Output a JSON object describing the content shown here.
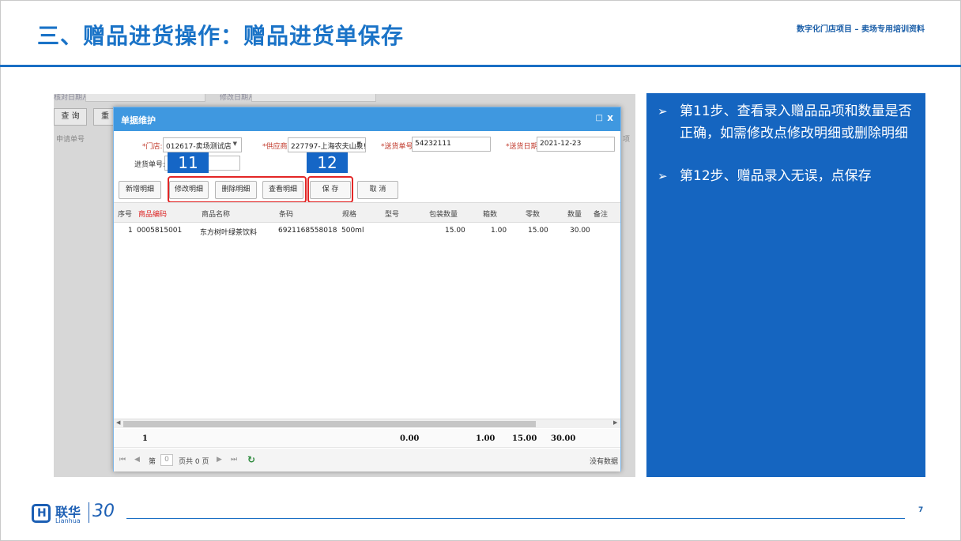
{
  "slide": {
    "title": "三、赠品进货操作：赠品进货单保存",
    "subtitle": "数字化门店项目 – 卖场专用培训资料",
    "page_number": "7"
  },
  "background_app": {
    "label_a": "核对日期从:",
    "label_b": "修改日期从:",
    "query_button": "查 询",
    "reset_button": "重",
    "column_apply_no": "申请单号",
    "column_right": "项"
  },
  "dialog": {
    "title": "单据维护",
    "max_icon": "□",
    "close_icon": "x",
    "fields": {
      "store_label": "*门店:",
      "store_value": "012617-卖场测试店",
      "supplier_label": "*供应商:",
      "supplier_value": "227797-上海农夫山泉!",
      "delivery_no_label": "*送货单号:",
      "delivery_no_value": "54232111",
      "delivery_date_label": "*送货日期:",
      "delivery_date_value": "2021-12-23",
      "purchase_no_label": "进货单号:",
      "purchase_no_value": ""
    },
    "buttons": {
      "add_detail": "新增明细",
      "edit_detail": "修改明细",
      "delete_detail": "删除明细",
      "view_detail": "查看明细",
      "save": "保 存",
      "cancel": "取 消"
    },
    "step_badges": {
      "step11": "11",
      "step12": "12"
    },
    "table": {
      "headers": [
        "序号",
        "商品编码",
        "商品名称",
        "条码",
        "规格",
        "型号",
        "包装数量",
        "箱数",
        "零数",
        "数量",
        "备注"
      ],
      "rows": [
        {
          "index": "1",
          "code": "0005815001",
          "name": "东方树叶绿茶饮料",
          "barcode": "6921168558018",
          "spec": "500ml",
          "model": "",
          "pack_qty": "15.00",
          "boxes": "1.00",
          "loose": "15.00",
          "qty": "30.00",
          "remark": ""
        }
      ],
      "footer": {
        "count": "1",
        "pack_total": "0.00",
        "boxes_total": "1.00",
        "loose_total": "15.00",
        "qty_total": "30.00"
      }
    },
    "pager": {
      "page_prefix": "第",
      "page_value": "0",
      "page_suffix": "页共 0 页",
      "no_data": "没有数据"
    }
  },
  "notes": [
    {
      "arrow": "➢",
      "text": "第11步、查看录入赠品品项和数量是否正确，如需修改点修改明细或删除明细"
    },
    {
      "arrow": "➢",
      "text": "第12步、赠品录入无误，点保存"
    }
  ],
  "logo": {
    "cn": "联华",
    "en": "Lianhua",
    "anniv": "30"
  },
  "colors": {
    "brand_blue": "#1565c0",
    "title_blue": "#1a73c7",
    "highlight_red": "#e32626",
    "dialog_header": "#3f98e0"
  }
}
